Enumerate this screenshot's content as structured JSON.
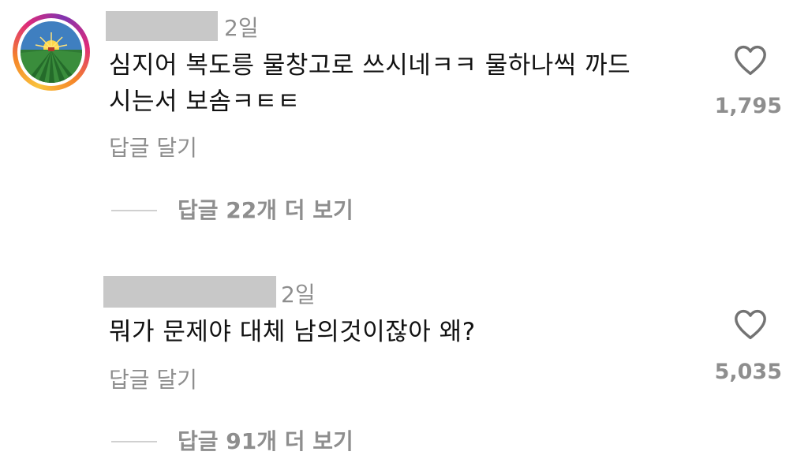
{
  "comments": [
    {
      "time": "2일",
      "text_line1": "심지어 복도릉 물창고로 쓰시네ㅋㅋ 물하나씩 까드",
      "text_line2": "시는서 보솜ㅋㅌㅌ",
      "reply_label": "답글 달기",
      "view_replies_label": "답글 22개 더 보기",
      "like_count": "1,795",
      "has_avatar": true
    },
    {
      "time": "2일",
      "text_line1": "뭐가 문제야 대체 남의것이잖아 왜?",
      "reply_label": "답글 달기",
      "view_replies_label": "답글 91개 더 보기",
      "like_count": "5,035",
      "has_avatar": false
    }
  ],
  "icons": {
    "like": "heart-outline-icon",
    "avatar": "farm-landscape-avatar"
  },
  "colors": {
    "secondary_text": "#8e8e8e",
    "username_redaction": "#c8c8c8"
  }
}
